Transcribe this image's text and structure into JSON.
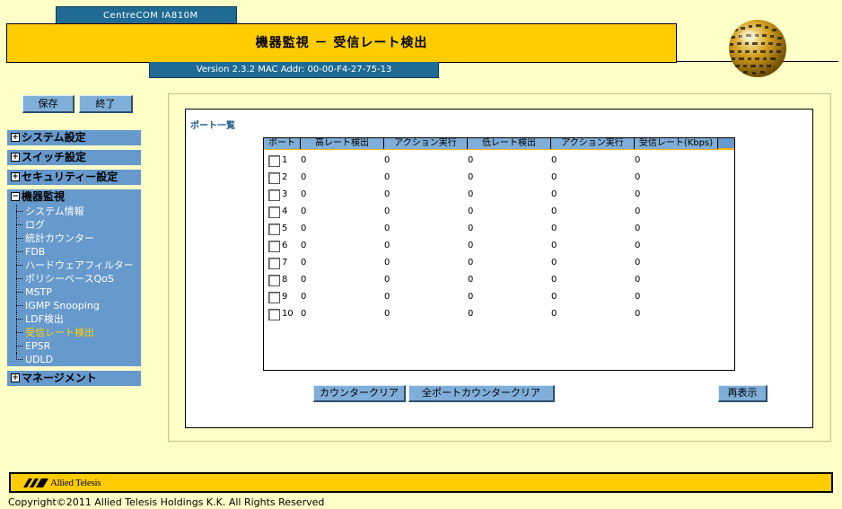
{
  "header": {
    "model": "CentreCOM IA810M",
    "title": "機器監視 － 受信レート検出",
    "version": "Version 2.3.2 MAC Addr: 00-00-F4-27-75-13"
  },
  "sidebar": {
    "save_label": "保存",
    "exit_label": "終了",
    "sections": [
      {
        "label": "システム設定",
        "toggle": "+"
      },
      {
        "label": "スイッチ設定",
        "toggle": "+"
      },
      {
        "label": "セキュリティー設定",
        "toggle": "+"
      },
      {
        "label": "機器監視",
        "toggle": "−"
      },
      {
        "label": "マネージメント",
        "toggle": "+"
      }
    ],
    "items": [
      {
        "label": "システム情報"
      },
      {
        "label": "ログ"
      },
      {
        "label": "統計カウンター"
      },
      {
        "label": "FDB"
      },
      {
        "label": "ハードウェアフィルター"
      },
      {
        "label": "ポリシーベースQoS"
      },
      {
        "label": "MSTP"
      },
      {
        "label": "IGMP Snooping"
      },
      {
        "label": "LDF検出"
      },
      {
        "label": "受信レート検出"
      },
      {
        "label": "EPSR"
      },
      {
        "label": "UDLD"
      }
    ]
  },
  "main": {
    "section_label": "ポート一覧",
    "columns": [
      "ポート",
      "高レート検出",
      "アクション実行",
      "低レート検出",
      "アクション実行",
      "受信レート(Kbps)"
    ],
    "rows": [
      {
        "port": "1",
        "high": "0",
        "action1": "0",
        "low": "0",
        "action2": "0",
        "rate": "0"
      },
      {
        "port": "2",
        "high": "0",
        "action1": "0",
        "low": "0",
        "action2": "0",
        "rate": "0"
      },
      {
        "port": "3",
        "high": "0",
        "action1": "0",
        "low": "0",
        "action2": "0",
        "rate": "0"
      },
      {
        "port": "4",
        "high": "0",
        "action1": "0",
        "low": "0",
        "action2": "0",
        "rate": "0"
      },
      {
        "port": "5",
        "high": "0",
        "action1": "0",
        "low": "0",
        "action2": "0",
        "rate": "0"
      },
      {
        "port": "6",
        "high": "0",
        "action1": "0",
        "low": "0",
        "action2": "0",
        "rate": "0"
      },
      {
        "port": "7",
        "high": "0",
        "action1": "0",
        "low": "0",
        "action2": "0",
        "rate": "0"
      },
      {
        "port": "8",
        "high": "0",
        "action1": "0",
        "low": "0",
        "action2": "0",
        "rate": "0"
      },
      {
        "port": "9",
        "high": "0",
        "action1": "0",
        "low": "0",
        "action2": "0",
        "rate": "0"
      },
      {
        "port": "10",
        "high": "0",
        "action1": "0",
        "low": "0",
        "action2": "0",
        "rate": "0"
      }
    ],
    "counter_clear_label": "カウンタークリア",
    "all_counter_clear_label": "全ポートカウンタークリア",
    "refresh_label": "再表示"
  },
  "footer": {
    "brand": "Allied Telesis",
    "copyright": "Copyright©2011 Allied Telesis Holdings K.K. All Rights Reserved"
  },
  "colors": {
    "background": "#FFFFC8",
    "header_yellow": "#FFCC00",
    "header_blue": "#1F6B93",
    "nav_blue": "#6699CC",
    "active_item": "#FFD200"
  }
}
